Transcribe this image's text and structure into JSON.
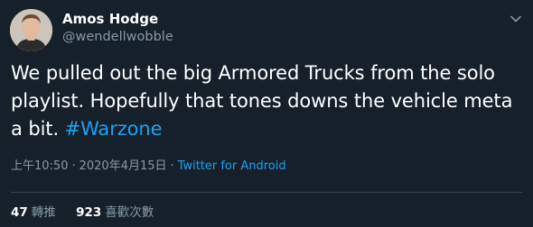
{
  "author": {
    "name": "Amos Hodge",
    "handle": "@wendellwobble"
  },
  "tweet": {
    "lines": [
      "We pulled out the big Armored Trucks from the solo",
      "playlist. Hopefully that tones downs the vehicle meta",
      "a bit."
    ],
    "hashtag": "#Warzone"
  },
  "meta": {
    "time": "上午10:50",
    "separator": "·",
    "date": "2020年4月15日",
    "source": "Twitter for Android"
  },
  "stats": {
    "retweets_count": "47",
    "retweets_label": "轉推",
    "likes_count": "923",
    "likes_label": "喜歡次數"
  },
  "colors": {
    "background": "#15202b",
    "text": "#ffffff",
    "secondary": "#8899a6",
    "accent": "#1da1f2",
    "divider": "#38444d"
  },
  "icons": {
    "menu": "chevron-down-icon"
  }
}
